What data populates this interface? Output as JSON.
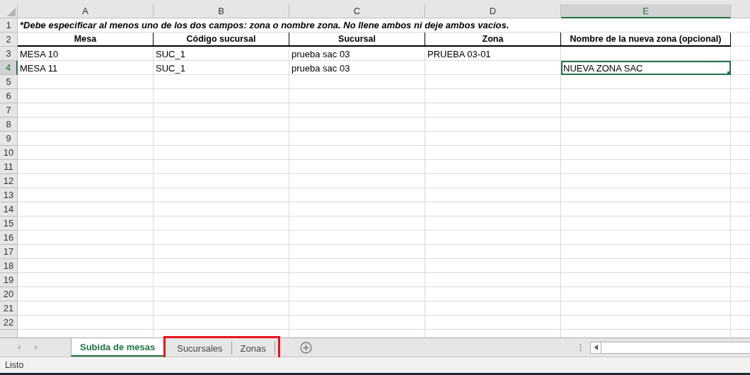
{
  "columns": [
    {
      "label": "A",
      "selected": false
    },
    {
      "label": "B",
      "selected": false
    },
    {
      "label": "C",
      "selected": false
    },
    {
      "label": "D",
      "selected": false
    },
    {
      "label": "E",
      "selected": true
    }
  ],
  "rows": [
    {
      "number": "1",
      "kind": "note",
      "selected": false,
      "text": "*Debe especificar al menos uno de los dos campos: zona o nombre zona. No llene ambos ni deje ambos vacíos."
    },
    {
      "number": "2",
      "kind": "header",
      "selected": false,
      "cells": [
        {
          "text": "Mesa"
        },
        {
          "text": "Código sucursal"
        },
        {
          "text": "Sucursal"
        },
        {
          "text": "Zona"
        },
        {
          "text": "Nombre de la nueva zona (opcional)"
        }
      ]
    },
    {
      "number": "3",
      "kind": "data",
      "selected": false,
      "cells": [
        {
          "text": "MESA 10",
          "selected": false
        },
        {
          "text": "SUC_1",
          "selected": false
        },
        {
          "text": "prueba sac 03",
          "selected": false
        },
        {
          "text": "PRUEBA 03-01",
          "selected": false
        },
        {
          "selected": false
        }
      ]
    },
    {
      "number": "4",
      "kind": "data",
      "selected": true,
      "cells": [
        {
          "text": "MESA 11",
          "selected": false
        },
        {
          "text": "SUC_1",
          "selected": false
        },
        {
          "text": "prueba sac 03",
          "selected": false
        },
        {
          "selected": false
        },
        {
          "text": "NUEVA ZONA SAC",
          "selected": true
        }
      ]
    },
    {
      "number": "5",
      "kind": "empty",
      "selected": false
    },
    {
      "number": "6",
      "kind": "empty",
      "selected": false
    },
    {
      "number": "7",
      "kind": "empty",
      "selected": false
    },
    {
      "number": "8",
      "kind": "empty",
      "selected": false
    },
    {
      "number": "9",
      "kind": "empty",
      "selected": false
    },
    {
      "number": "10",
      "kind": "empty",
      "selected": false
    },
    {
      "number": "11",
      "kind": "empty",
      "selected": false
    },
    {
      "number": "12",
      "kind": "empty",
      "selected": false
    },
    {
      "number": "13",
      "kind": "empty",
      "selected": false
    },
    {
      "number": "14",
      "kind": "empty",
      "selected": false
    },
    {
      "number": "15",
      "kind": "empty",
      "selected": false
    },
    {
      "number": "16",
      "kind": "empty",
      "selected": false
    },
    {
      "number": "17",
      "kind": "empty",
      "selected": false
    },
    {
      "number": "18",
      "kind": "empty",
      "selected": false
    },
    {
      "number": "19",
      "kind": "empty",
      "selected": false
    },
    {
      "number": "20",
      "kind": "empty",
      "selected": false
    },
    {
      "number": "21",
      "kind": "empty",
      "selected": false
    },
    {
      "number": "22",
      "kind": "empty",
      "selected": false
    }
  ],
  "sheet_tabs": [
    {
      "label": "Subida de mesas",
      "selected": true,
      "highlighted": false
    },
    {
      "label": "Sucursales",
      "selected": false,
      "highlighted": true
    },
    {
      "label": "Zonas",
      "selected": false,
      "highlighted": true
    }
  ],
  "status_bar": {
    "text": "Listo"
  }
}
